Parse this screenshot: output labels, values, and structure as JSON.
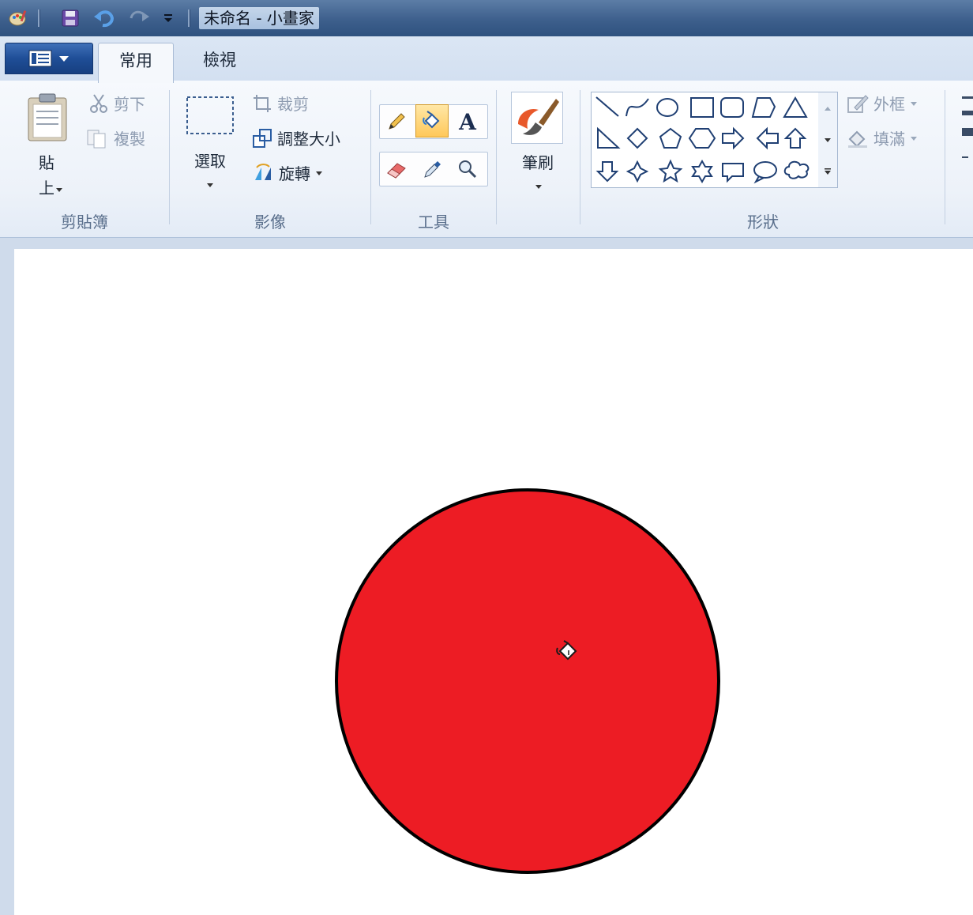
{
  "window": {
    "title": "未命名 - 小畫家"
  },
  "quick_access": {
    "save": "save-icon",
    "undo": "undo-icon",
    "redo": "redo-icon",
    "customize": "dropdown-icon"
  },
  "tabs": [
    {
      "label": "常用",
      "selected": true
    },
    {
      "label": "檢視",
      "selected": false
    }
  ],
  "ribbon": {
    "clipboard": {
      "label": "剪貼簿",
      "paste": "貼\n上",
      "cut": "剪下",
      "copy": "複製"
    },
    "image": {
      "label": "影像",
      "select": "選取",
      "crop": "裁剪",
      "resize": "調整大小",
      "rotate": "旋轉"
    },
    "tools": {
      "label": "工具",
      "text_tool_glyph": "A"
    },
    "brushes": {
      "label": "筆刷"
    },
    "shapes": {
      "label": "形狀",
      "outline": "外框",
      "fill": "填滿"
    }
  },
  "canvas": {
    "shape": "circle",
    "fill_color": "#ed1c24",
    "outline_color": "#000000",
    "cursor": "fill-bucket-cursor-icon"
  },
  "colors": {
    "accent_blue": "#1f4e97",
    "active_tool": "#ffc85a"
  }
}
